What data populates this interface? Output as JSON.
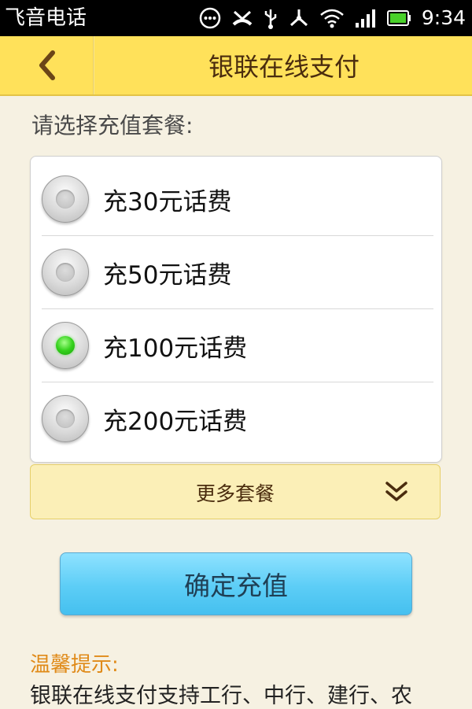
{
  "status_bar": {
    "carrier": "飞音电话",
    "time": "9:34",
    "icons": [
      "chat-icon",
      "missed-call-icon",
      "usb-icon",
      "usb-share-icon",
      "wifi-icon",
      "signal-icon",
      "battery-icon"
    ]
  },
  "header": {
    "back_icon": "chevron-left-icon",
    "title": "银联在线支付"
  },
  "section": {
    "label": "请选择充值套餐:"
  },
  "options": [
    {
      "label": "充30元话费",
      "selected": false
    },
    {
      "label": "充50元话费",
      "selected": false
    },
    {
      "label": "充100元话费",
      "selected": true
    },
    {
      "label": "充200元话费",
      "selected": false
    }
  ],
  "more": {
    "label": "更多套餐",
    "icon": "double-chevron-down-icon"
  },
  "confirm": {
    "label": "确定充值"
  },
  "tip": {
    "title": "温馨提示:",
    "text": "银联在线支付支持工行、中行、建行、农"
  },
  "colors": {
    "header_bg": "#ffe15a",
    "page_bg": "#f6f1e2",
    "confirm_bg": "#5ccdf6",
    "selected_radio": "#35d21d",
    "tip_title": "#e08a18"
  }
}
